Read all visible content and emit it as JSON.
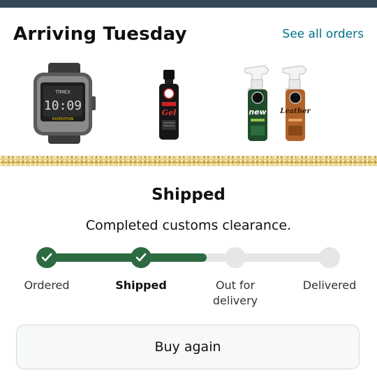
{
  "header": {
    "arriving_title": "Arriving Tuesday",
    "see_all_label": "See all orders"
  },
  "products": [
    {
      "name": "watch-image",
      "watch_brand": "TIMEX",
      "watch_time": "10:09",
      "watch_subtext": "EXPEDITION"
    },
    {
      "name": "tire-shine-bottle",
      "label": "Tire+Trim Gel"
    },
    {
      "name": "spray-bottle-green",
      "label": "New Car Scent"
    },
    {
      "name": "spray-bottle-orange",
      "label": "Leather Scent"
    }
  ],
  "status": {
    "title": "Shipped",
    "detail": "Completed customs clearance."
  },
  "tracker": {
    "progress_fraction": 0.56,
    "steps": [
      {
        "line1": "Ordered",
        "line2": "",
        "done": true,
        "current": false
      },
      {
        "line1": "Shipped",
        "line2": "",
        "done": true,
        "current": true
      },
      {
        "line1": "Out for",
        "line2": "delivery",
        "done": false,
        "current": false
      },
      {
        "line1": "Delivered",
        "line2": "",
        "done": false,
        "current": false
      }
    ]
  },
  "actions": {
    "buy_again_label": "Buy again"
  },
  "colors": {
    "accent_green": "#2d6a42",
    "link_teal": "#007185",
    "track_gray": "#e6e6e6",
    "header_strip": "#37475a"
  }
}
